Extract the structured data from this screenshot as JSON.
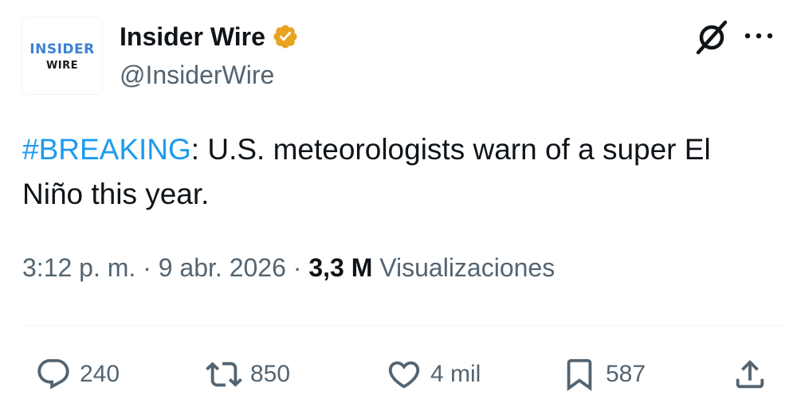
{
  "author": {
    "avatar_line1": "INSIDER",
    "avatar_line2": "WIRE",
    "display_name": "Insider Wire",
    "handle": "@InsiderWire",
    "verified_badge_color": "#e8a321"
  },
  "header_icons": [
    "grok-icon",
    "more-icon"
  ],
  "tweet": {
    "hashtag": "#BREAKING",
    "text_after_hashtag": ": U.S. meteorologists warn of a super El Niño this year."
  },
  "meta": {
    "time": "3:12 p. m.",
    "separator": " · ",
    "date": "9 abr. 2026",
    "views_count": "3,3 M",
    "views_label": "Visualizaciones"
  },
  "actions": {
    "replies": "240",
    "retweets": "850",
    "likes": "4 mil",
    "bookmarks": "587"
  },
  "colors": {
    "text": "#0f1419",
    "secondary": "#536471",
    "link": "#1d9bf0",
    "brand_blue": "#3b82d6"
  }
}
